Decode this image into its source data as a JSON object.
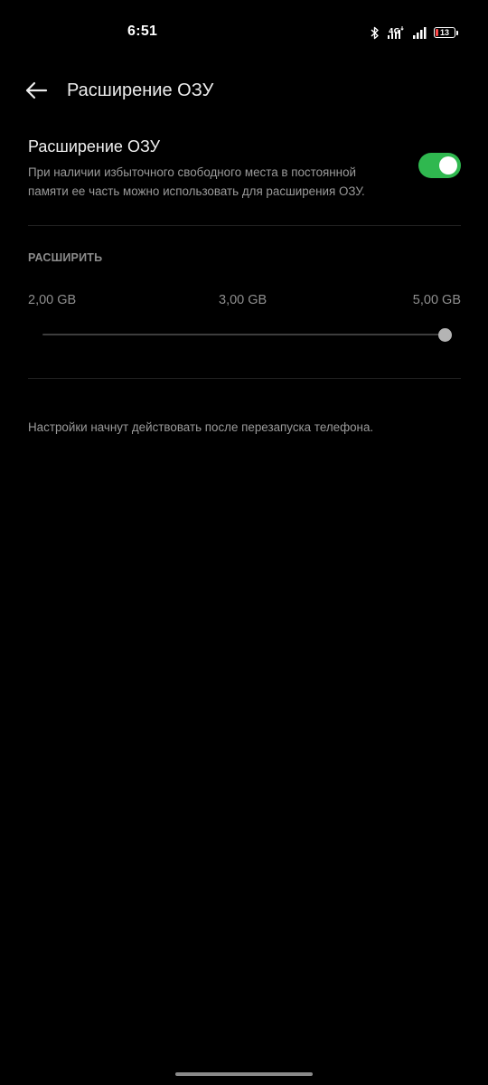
{
  "status_bar": {
    "time": "6:51",
    "network_label": "4G",
    "battery_level": "13",
    "battery_color": "#ff4a4a",
    "icons": [
      "bluetooth-icon",
      "network-4g-icon",
      "signal-icon",
      "battery-icon"
    ]
  },
  "header": {
    "back_icon": "arrow-left-icon",
    "title": "Расширение ОЗУ"
  },
  "ram_expansion": {
    "title": "Расширение ОЗУ",
    "description": "При наличии избыточного свободного места в постоянной памяти ее часть можно использовать для расширения ОЗУ.",
    "enabled": true,
    "accent_color": "#2fb84f"
  },
  "expand_section": {
    "header": "РАСШИРИТЬ",
    "options": [
      "2,00 GB",
      "3,00 GB",
      "5,00 GB"
    ],
    "selected": "5,00 GB",
    "slider_value_fraction": 1.0
  },
  "note": "Настройки начнут действовать после перезапуска телефона."
}
